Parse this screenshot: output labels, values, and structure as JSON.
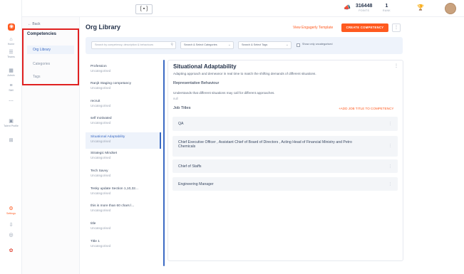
{
  "topbar": {
    "brand_glyph": "[ ▪ ]",
    "points": {
      "value": "316448",
      "label": "POINTS"
    },
    "rank": {
      "value": "1",
      "label": "RANK"
    }
  },
  "rail": {
    "items": [
      {
        "icon": "⌂",
        "label": "Home"
      },
      {
        "icon": "☰",
        "label": "Teams"
      },
      {
        "icon": "▦",
        "label": "Admin"
      },
      {
        "icon": "≡",
        "label": "Skill"
      },
      {
        "icon": "⋯",
        "label": ""
      },
      {
        "icon": "▣",
        "label": "Talent Profile"
      },
      {
        "icon": "⊞",
        "label": ""
      }
    ],
    "bottom": [
      {
        "icon": "⚙",
        "label": "Settings"
      },
      {
        "icon": "⇩",
        "label": ""
      },
      {
        "icon": "◎",
        "label": ""
      }
    ]
  },
  "subnav": {
    "back": "Back",
    "title": "Competencies",
    "items": [
      "Org Library",
      "Categories",
      "Tags"
    ]
  },
  "main": {
    "title": "Org Library",
    "view_template": "View Engagerly Template",
    "create_button": "CREATE COMPETENCY",
    "more": "⋮",
    "search_placeholder": "Search by competency, description & behaviours",
    "category_select": "Search & Select Categories",
    "tag_select": "Search & Select Tags",
    "show_uncategorised": "Show only uncategorised"
  },
  "competencies": [
    {
      "name": "Profession",
      "category": "Uncategorised"
    },
    {
      "name": "Ranjit Staging competancy",
      "category": "Uncategorised"
    },
    {
      "name": "recruit",
      "category": "Uncategorised"
    },
    {
      "name": "self motivated",
      "category": "Uncategorised"
    },
    {
      "name": "Situational Adaptability",
      "category": "Uncategorised"
    },
    {
      "name": "Strategic Mindset",
      "category": "Uncategorised"
    },
    {
      "name": "Tech Savvy",
      "category": "Uncategorised"
    },
    {
      "name": "Tesky update Section 1,10,32...",
      "category": "Uncategorised"
    },
    {
      "name": "this is more than 60 chars l...",
      "category": "Uncategorised"
    },
    {
      "name": "title",
      "category": "Uncategorised"
    },
    {
      "name": "Title 1",
      "category": "Uncategorised"
    }
  ],
  "detail": {
    "title": "Situational Adaptability",
    "description": "Adapting approach and demeanor in real time to match the shifting demands of different situations.",
    "rep_behaviour_heading": "Representative Behaviour",
    "rep_behaviour_text": "Understands that different situations may call for different approaches.",
    "null_text": "null",
    "job_titles_heading": "Job Titles",
    "add_job_title": "+ADD JOB TITLE TO COMPETENCY",
    "menu": "⋮",
    "job_titles": [
      "QA",
      "Chief Executive Officer , Assistant Chief of Board of Directors , Acting Head of Financial Ministry and Petro Chemicals",
      "Chief of Staffs",
      "Engineering Manager"
    ]
  },
  "colors": {
    "accent": "#ff5a1f",
    "link": "#3c6bc4",
    "highlight": "#e02020"
  }
}
